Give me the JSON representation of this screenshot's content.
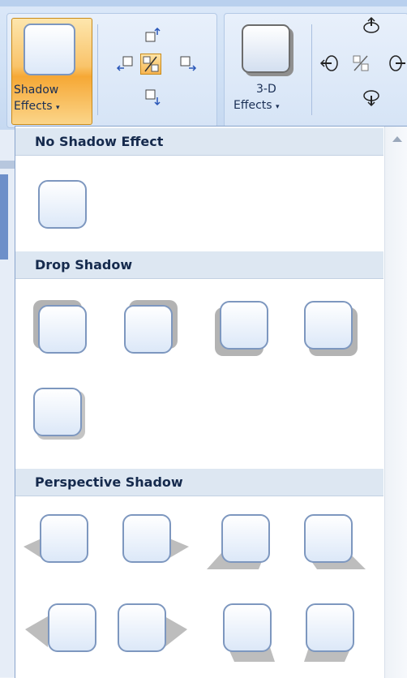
{
  "ribbon": {
    "shadow_effects": {
      "line1": "Shadow",
      "line2": "Effects"
    },
    "three_d_effects": {
      "line1": "3-D",
      "line2": "Effects"
    },
    "caret": "▾"
  },
  "gallery": {
    "sections": [
      {
        "title": "No Shadow Effect",
        "options": 1
      },
      {
        "title": "Drop Shadow",
        "options": 5
      },
      {
        "title": "Perspective Shadow",
        "options": 8
      }
    ]
  },
  "colors": {
    "accent": "#f6a835",
    "header_bg": "#dde7f2",
    "shadow": "#b3b3b3"
  }
}
